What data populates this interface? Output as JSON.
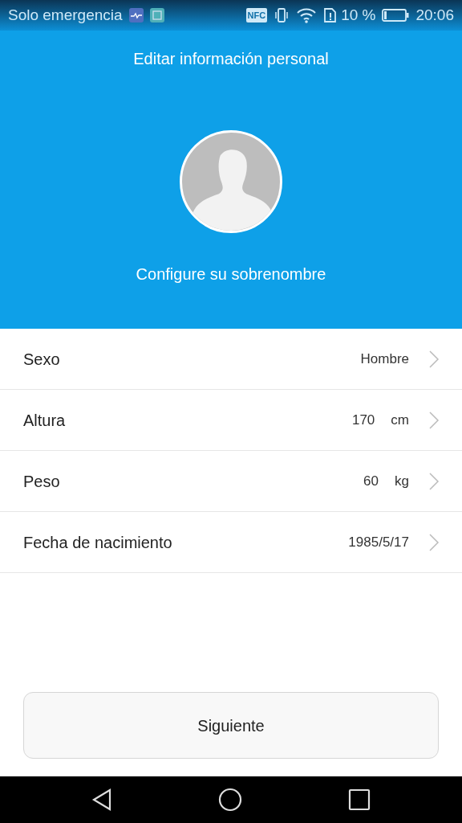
{
  "status_bar": {
    "carrier": "Solo emergencia",
    "nfc": "NFC",
    "battery_text": "10 %",
    "time": "20:06"
  },
  "header": {
    "title": "Editar información personal",
    "nickname": "Configure su sobrenombre"
  },
  "fields": [
    {
      "label": "Sexo",
      "value": "Hombre"
    },
    {
      "label": "Altura",
      "value": "170",
      "unit": "cm"
    },
    {
      "label": "Peso",
      "value": "60",
      "unit": "kg"
    },
    {
      "label": "Fecha de nacimiento",
      "value": "1985/5/17"
    }
  ],
  "next_button": "Siguiente"
}
